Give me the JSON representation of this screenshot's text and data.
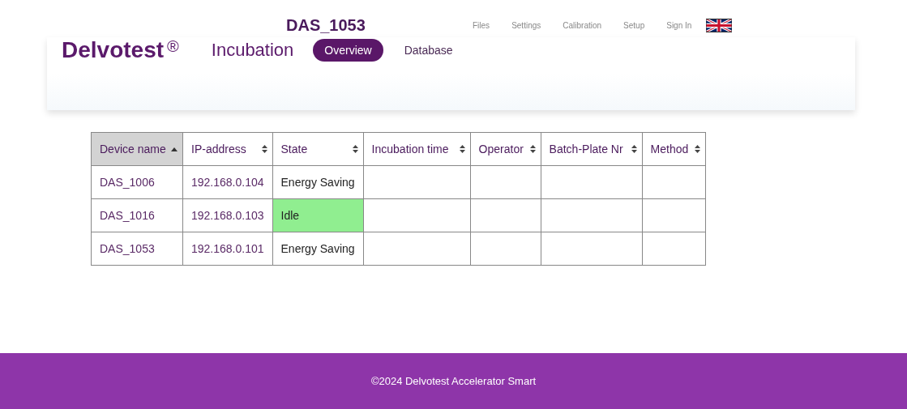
{
  "device_title": "DAS_1053",
  "top_nav": [
    {
      "label": "Files"
    },
    {
      "label": "Settings"
    },
    {
      "label": "Calibration"
    },
    {
      "label": "Setup"
    },
    {
      "label": "Sign In"
    }
  ],
  "brand": {
    "name": "Delvotest",
    "mark": "®"
  },
  "section_title": "Incubation",
  "tabs": [
    {
      "label": "Overview",
      "selected": true
    },
    {
      "label": "Database",
      "selected": false
    }
  ],
  "table": {
    "columns": [
      {
        "label": "Device name",
        "sorted": true
      },
      {
        "label": "IP-address",
        "sorted": false
      },
      {
        "label": "State",
        "sorted": false
      },
      {
        "label": "Incubation time",
        "sorted": false
      },
      {
        "label": "Operator",
        "sorted": false
      },
      {
        "label": "Batch-Plate Nr",
        "sorted": false
      },
      {
        "label": "Method",
        "sorted": false
      }
    ],
    "rows": [
      {
        "device": "DAS_1006",
        "ip": "192.168.0.104",
        "state": {
          "text": "Energy Saving",
          "color": "#ffffff"
        }
      },
      {
        "device": "DAS_1016",
        "ip": "192.168.0.103",
        "state": {
          "text": "Idle",
          "color": "#90ee90"
        }
      },
      {
        "device": "DAS_1053",
        "ip": "192.168.0.101",
        "state": {
          "text": "Energy Saving",
          "color": "#ffffff"
        }
      }
    ]
  },
  "footer": "©2024 Delvotest Accelerator Smart"
}
